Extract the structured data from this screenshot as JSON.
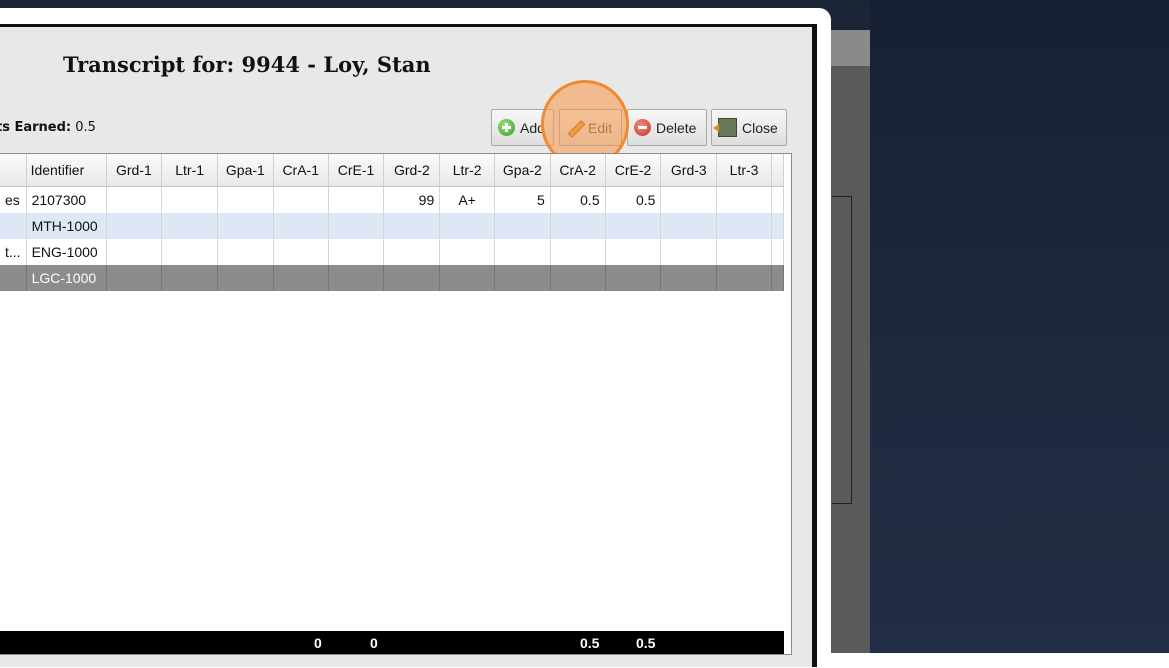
{
  "modal": {
    "title": "Transcript for: 9944 - Loy, Stan",
    "credits_label": "ts Earned:",
    "credits_value": "0.5"
  },
  "toolbar": {
    "add_label": "Add",
    "edit_label": "Edit",
    "delete_label": "Delete",
    "close_label": "Close"
  },
  "grid": {
    "columns": [
      "",
      "Identifier",
      "Grd-1",
      "Ltr-1",
      "Gpa-1",
      "CrA-1",
      "CrE-1",
      "Grd-2",
      "Ltr-2",
      "Gpa-2",
      "CrA-2",
      "CrE-2",
      "Grd-3",
      "Ltr-3",
      ""
    ],
    "rows": [
      [
        "es",
        "2107300",
        "",
        "",
        "",
        "",
        "",
        "99",
        "A+",
        "5",
        "0.5",
        "0.5",
        "",
        "",
        ""
      ],
      [
        "",
        "MTH-1000",
        "",
        "",
        "",
        "",
        "",
        "",
        "",
        "",
        "",
        "",
        "",
        "",
        ""
      ],
      [
        "t...",
        "ENG-1000",
        "",
        "",
        "",
        "",
        "",
        "",
        "",
        "",
        "",
        "",
        "",
        "",
        ""
      ],
      [
        "",
        "LGC-1000",
        "",
        "",
        "",
        "",
        "",
        "",
        "",
        "",
        "",
        "",
        "",
        "",
        ""
      ]
    ],
    "selected_row": 3,
    "totals": [
      "0",
      "0",
      "0.5",
      "0.5"
    ]
  }
}
